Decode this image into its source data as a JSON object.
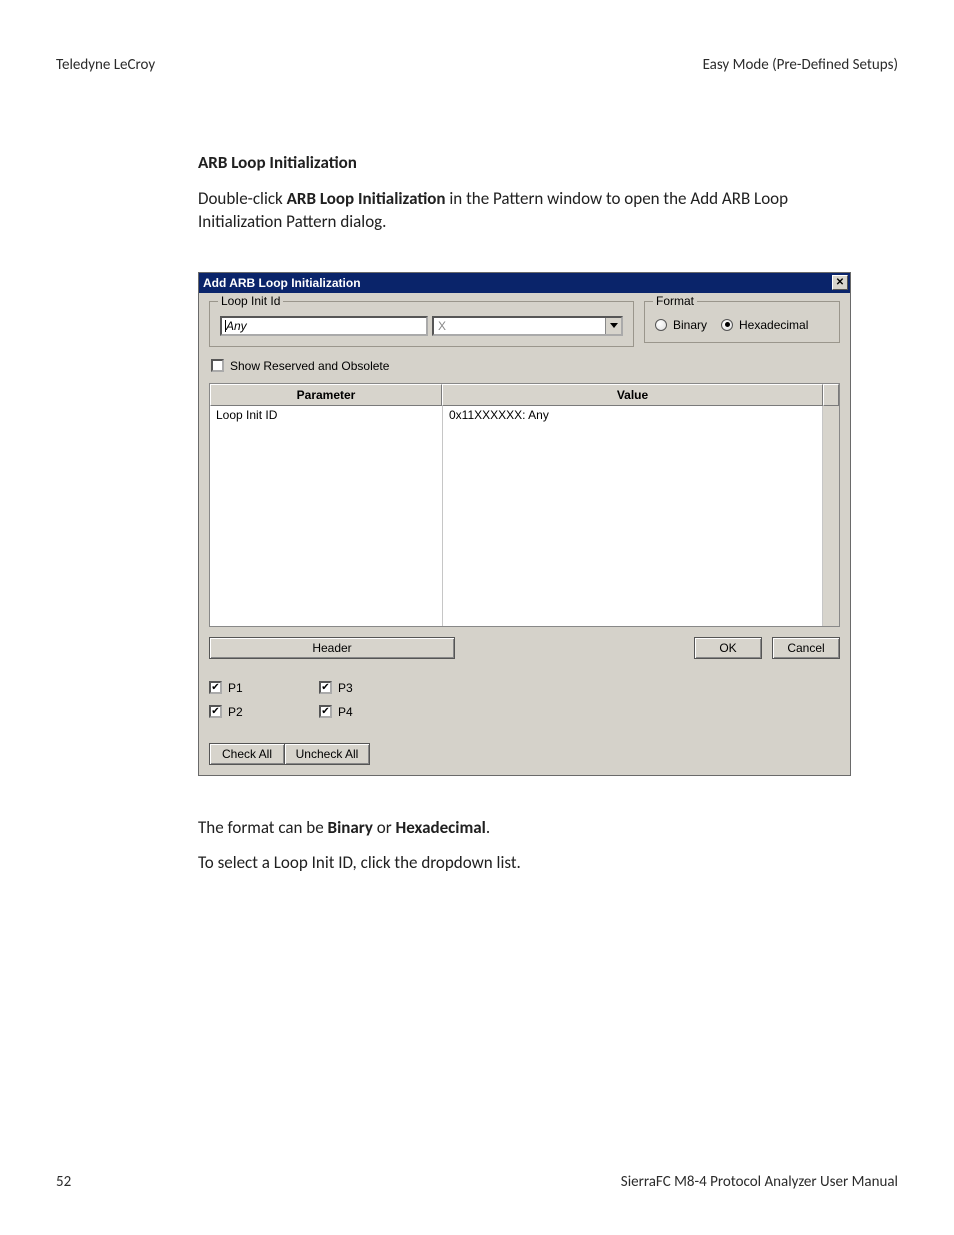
{
  "header": {
    "left": "Teledyne LeCroy",
    "right": "Easy Mode (Pre-Defined Setups)"
  },
  "section": {
    "heading": "ARB Loop Initialization",
    "para1_pre": "Double-click ",
    "para1_bold": "ARB Loop Initialization",
    "para1_post": " in the Pattern window to open the Add ARB Loop Initialization Pattern dialog."
  },
  "dialog": {
    "title": "Add ARB Loop Initialization",
    "loop_group_label": "Loop Init Id",
    "loop_text_value": "Any",
    "combo_placeholder": "X",
    "format_group_label": "Format",
    "radio_binary": "Binary",
    "radio_hex": "Hexadecimal",
    "show_reserved_label": "Show Reserved and Obsolete",
    "grid": {
      "col_param": "Parameter",
      "col_value": "Value",
      "rows": [
        {
          "param": "Loop Init ID",
          "value": "0x11XXXXXX: Any"
        }
      ]
    },
    "btn_header": "Header",
    "btn_ok": "OK",
    "btn_cancel": "Cancel",
    "ports": {
      "p1": "P1",
      "p2": "P2",
      "p3": "P3",
      "p4": "P4"
    },
    "btn_check_all": "Check All",
    "btn_uncheck_all": "Uncheck All"
  },
  "post": {
    "line1_pre": "The format can be ",
    "line1_b1": "Binary",
    "line1_mid": " or ",
    "line1_b2": "Hexadecimal",
    "line1_post": ".",
    "line2": "To select a Loop Init ID, click the dropdown list."
  },
  "footer": {
    "page": "52",
    "manual": "SierraFC M8-4 Protocol Analyzer User Manual"
  }
}
